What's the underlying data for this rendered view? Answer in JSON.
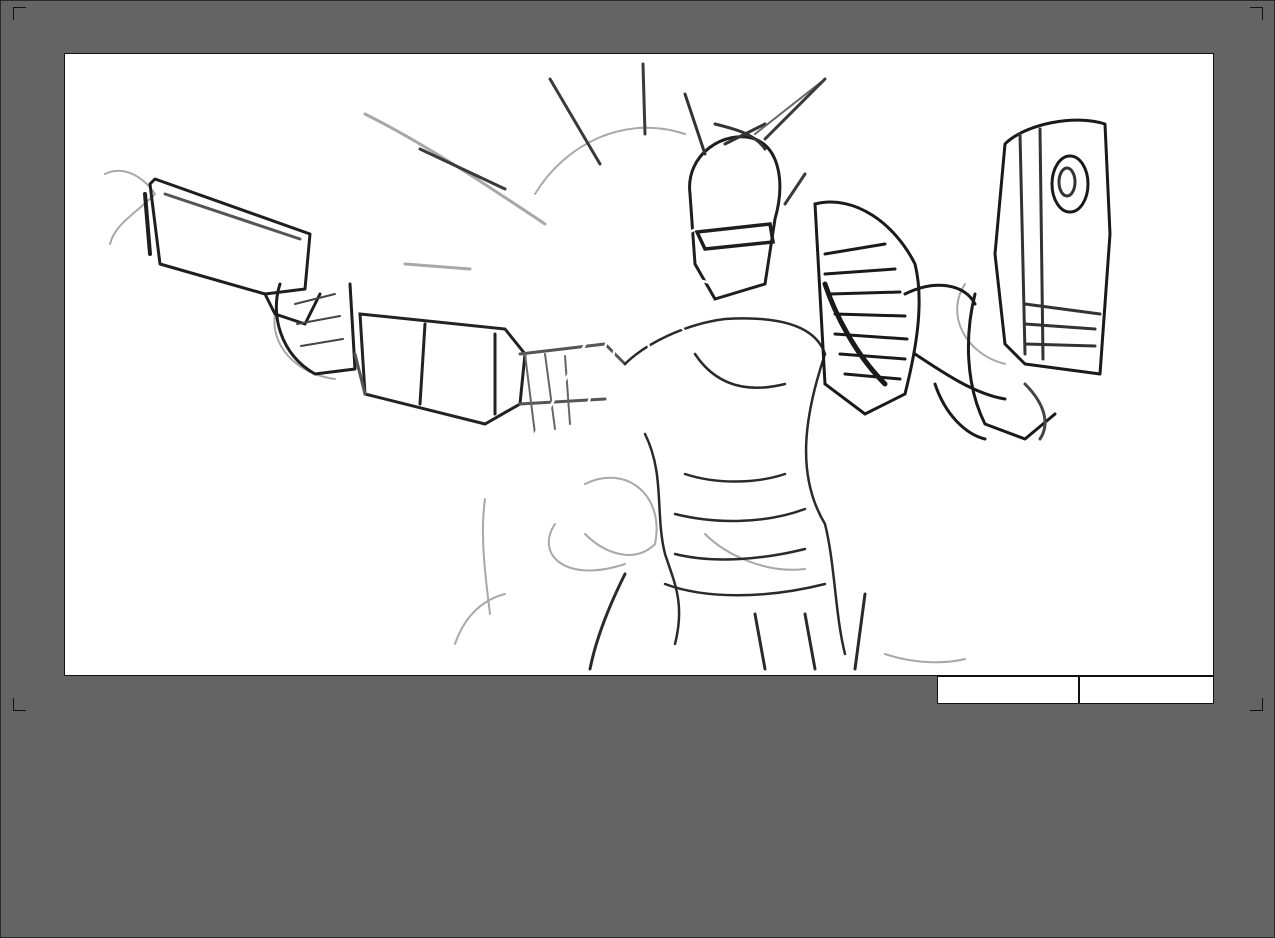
{
  "storyboard": {
    "scene_number": "",
    "panel_number": "",
    "colors": {
      "page_background": "#646464",
      "panel_background": "#ffffff",
      "ink_dark": "#1e1e1e",
      "ink_light": "#9a9a9a"
    },
    "sketch_subject": "figure-with-pistol-and-shield-muzzle-flash"
  }
}
